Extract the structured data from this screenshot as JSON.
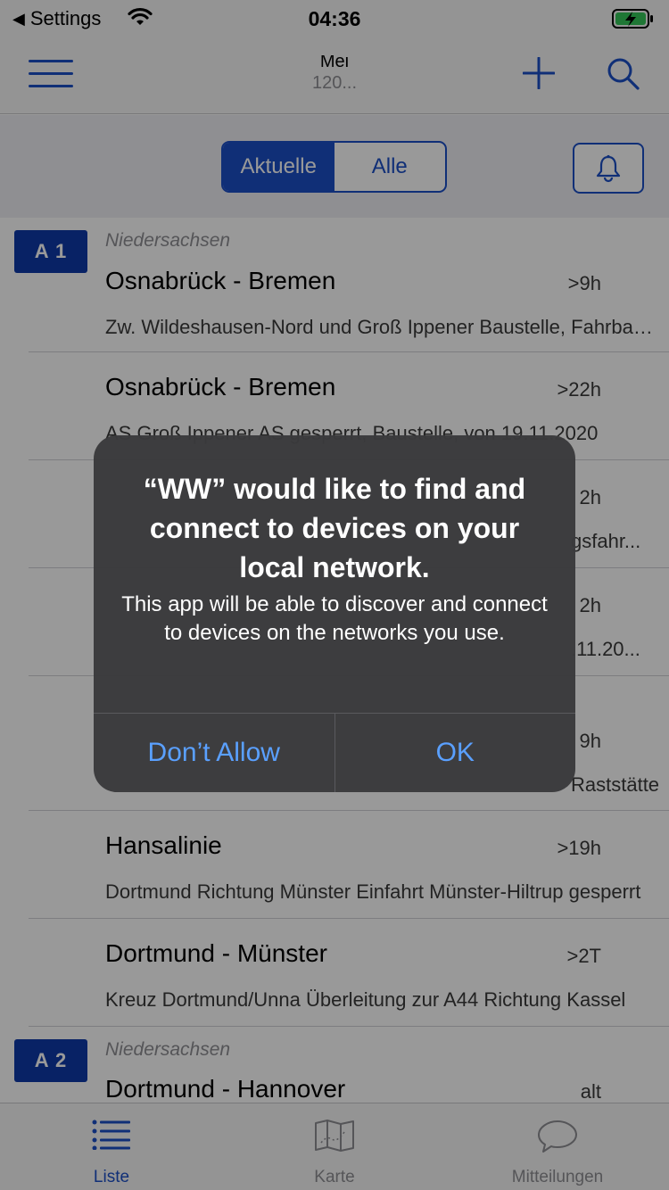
{
  "status_bar": {
    "back_label": "Settings",
    "time": "04:36"
  },
  "nav": {
    "title": "Mei",
    "subtitle": "120..."
  },
  "segments": {
    "current": "Aktuelle",
    "all": "Alle",
    "selected": "Aktuelle"
  },
  "sections": [
    {
      "road": "A 1",
      "region": "Niedersachsen",
      "rows": [
        {
          "route": "Osnabrück - Bremen",
          "age": ">9h",
          "desc": "Zw. Wildeshausen-Nord und Groß Ippener Baustelle, Fahrbahnverengung"
        },
        {
          "route": "Osnabrück - Bremen",
          "age": ">22h",
          "desc": "AS Groß Ippener AS gesperrt, Baustelle, von 19.11.2020"
        },
        {
          "route": "",
          "age": "2h",
          "desc": "gsfahr..."
        },
        {
          "route": "",
          "age": "2h",
          "desc": ".11.20..."
        },
        {
          "route": "",
          "age": "9h",
          "desc": "Raststätte"
        },
        {
          "route": "Hansalinie",
          "age": ">19h",
          "desc": "Dortmund Richtung Münster Einfahrt Münster-Hiltrup gesperrt"
        },
        {
          "route": "Dortmund - Münster",
          "age": ">2T",
          "desc": "Kreuz Dortmund/Unna Überleitung zur A44 Richtung Kassel"
        }
      ]
    },
    {
      "road": "A 2",
      "region": "Niedersachsen",
      "rows": [
        {
          "route": "Dortmund - Hannover",
          "age": "alt",
          "desc": ""
        }
      ]
    }
  ],
  "tabs": [
    {
      "label": "Liste",
      "icon": "list-icon",
      "active": true
    },
    {
      "label": "Karte",
      "icon": "map-icon",
      "active": false
    },
    {
      "label": "Mitteilungen",
      "icon": "chat-bubble-icon",
      "active": false
    }
  ],
  "alert": {
    "title": "“WW” would like to find and connect to devices on your local network.",
    "message": "This app will be able to discover and connect to devices on the networks you use.",
    "deny_label": "Don’t Allow",
    "ok_label": "OK"
  },
  "colors": {
    "accent": "#1c4fc6",
    "badge": "#0e3aa8",
    "alert_button": "#5aa0ff"
  }
}
